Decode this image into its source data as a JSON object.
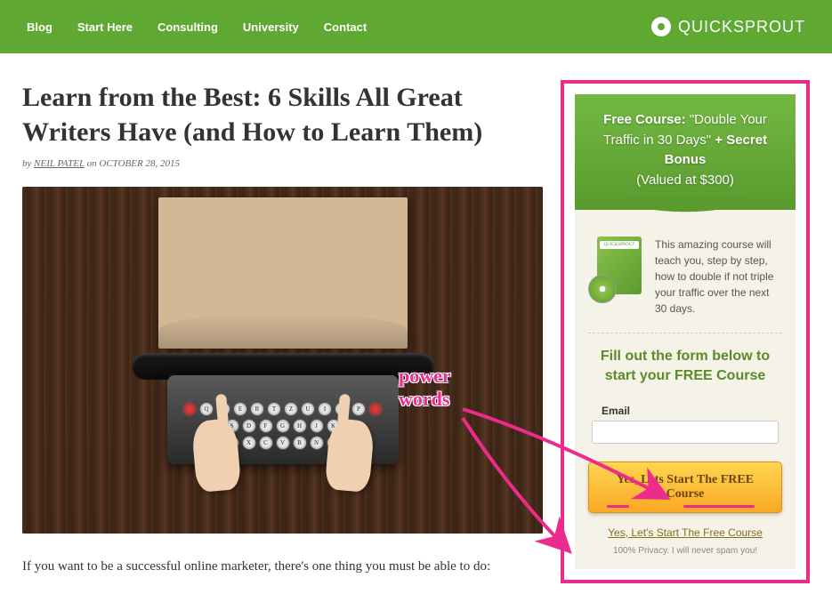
{
  "nav": {
    "items": [
      "Blog",
      "Start Here",
      "Consulting",
      "University",
      "Contact"
    ]
  },
  "brand": "QUICKSPROUT",
  "article": {
    "title": "Learn from the Best: 6 Skills All Great Writers Have (and How to Learn Them)",
    "by_prefix": "by",
    "author": "NEIL PATEL",
    "on_prefix": "on",
    "date": "OCTOBER 28, 2015",
    "body_first": "If you want to be a successful online marketer, there's one thing you must be able to do:"
  },
  "sidebar": {
    "header_bold1": "Free Course:",
    "header_quote": "\"Double Your Traffic in 30 Days\"",
    "header_plus": "+ Secret Bonus",
    "header_value": "(Valued at $300)",
    "description": "This amazing course will teach you, step by step, how to double if not triple your traffic over the next 30 days.",
    "form_title": "Fill out the form below to start your FREE Course",
    "email_label": "Email",
    "cta_label": "Yes, Lets Start The FREE Course",
    "alt_link": "Yes, Let's Start The Free Course",
    "privacy": "100% Privacy. I will never spam you!"
  },
  "annotation": {
    "label1": "power",
    "label2": "words"
  }
}
